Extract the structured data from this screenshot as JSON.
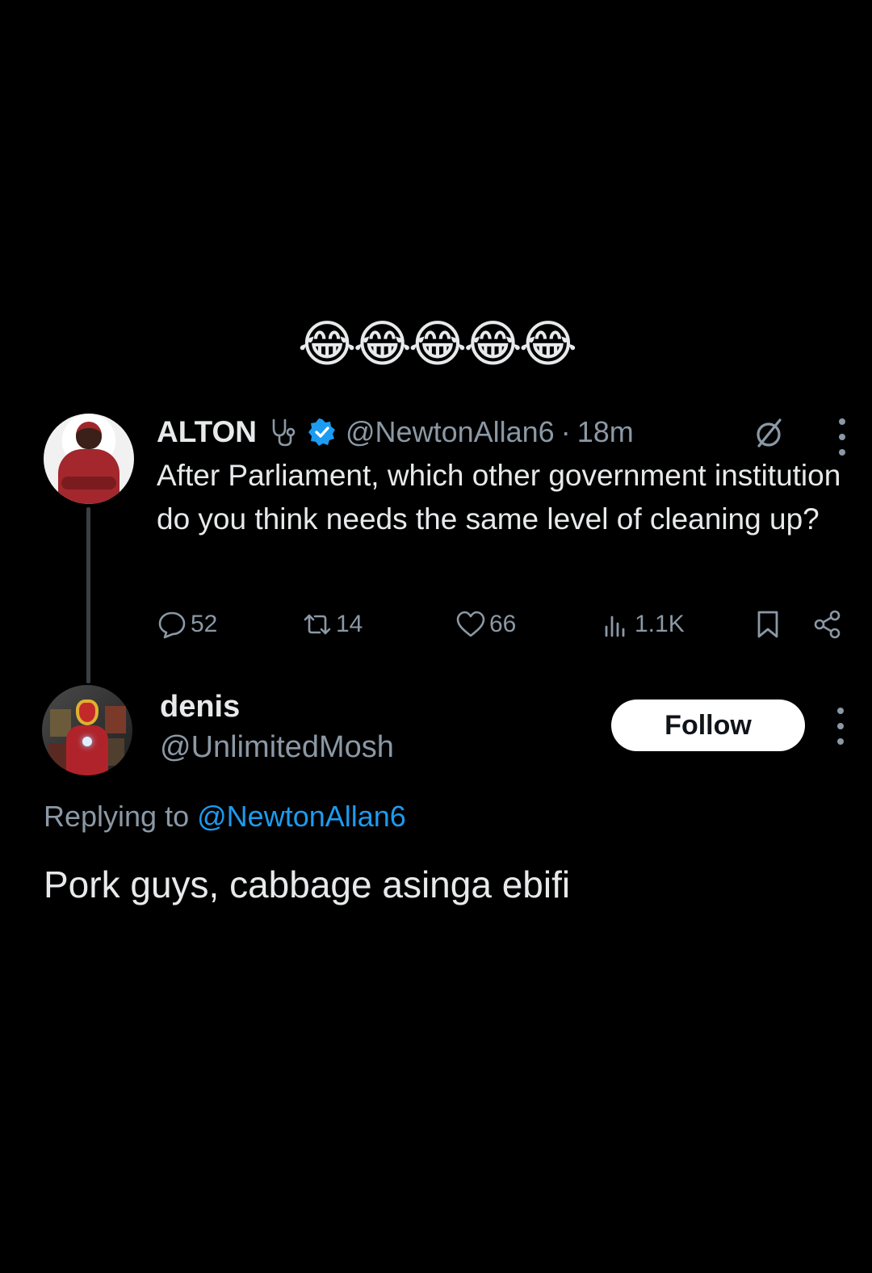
{
  "caption": {
    "emojis": "😂😂😂😂😂"
  },
  "parent_tweet": {
    "display_name": "ALTON",
    "handle": "@NewtonAllan6",
    "separator": "·",
    "time": "18m",
    "text": "After Parliament, which other government institution do you think needs the same level of cleaning up?",
    "icons": {
      "name_badge": "stethoscope-icon",
      "verified": "verified-badge-icon",
      "grok": "slash-circle-icon",
      "more": "more-options-icon"
    },
    "actions": {
      "replies": "52",
      "retweets": "14",
      "likes": "66",
      "views": "1.1K"
    }
  },
  "reply_tweet": {
    "display_name": "denis",
    "handle": "@UnlimitedMosh",
    "follow_label": "Follow",
    "replying_prefix": "Replying to",
    "replying_to": "@NewtonAllan6",
    "text": "Pork guys, cabbage asinga ebifi"
  },
  "colors": {
    "background": "#000000",
    "primary_text": "#e7e9ea",
    "secondary_text": "#8b98a5",
    "link": "#1d9bf0",
    "verified": "#1d9bf0"
  }
}
